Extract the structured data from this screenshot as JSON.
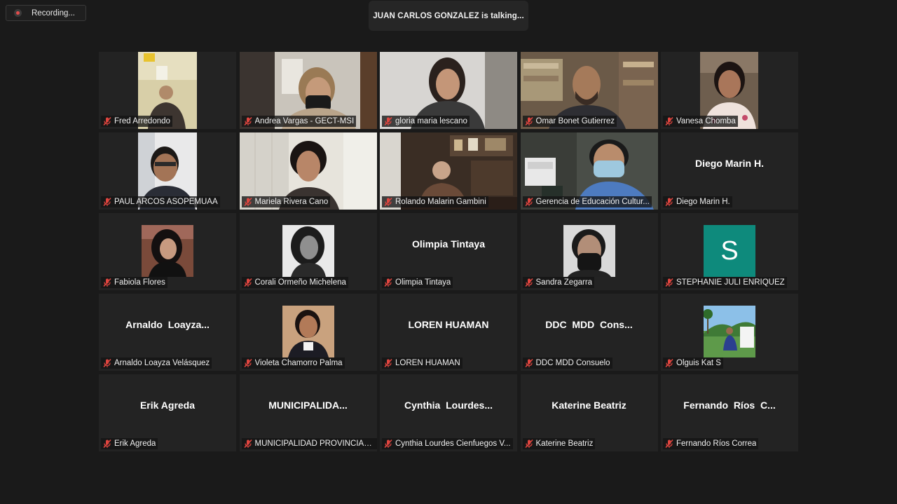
{
  "recording": {
    "label": "Recording..."
  },
  "talking": {
    "label": "JUAN CARLOS GONZALEZ is talking..."
  },
  "participants": [
    {
      "name": "Fred Arredondo",
      "center": ""
    },
    {
      "name": "Andrea Vargas - GECT-MSI",
      "center": ""
    },
    {
      "name": "gloria maria lescano",
      "center": ""
    },
    {
      "name": "Omar Bonet Gutierrez",
      "center": ""
    },
    {
      "name": "Vanesa Chomba",
      "center": ""
    },
    {
      "name": "PAUL ARCOS ASOPEMUAA",
      "center": ""
    },
    {
      "name": "Mariela Rivera Cano",
      "center": ""
    },
    {
      "name": "Rolando Malarin Gambini",
      "center": ""
    },
    {
      "name": "Gerencia de Educación Cultur...",
      "center": ""
    },
    {
      "name": "Diego Marin H.",
      "center": "Diego Marin H."
    },
    {
      "name": "Fabiola Flores",
      "center": ""
    },
    {
      "name": "Corali Ormeño Michelena",
      "center": ""
    },
    {
      "name": "Olimpia Tintaya",
      "center": "Olimpia Tintaya"
    },
    {
      "name": "Sandra Zegarra",
      "center": ""
    },
    {
      "name": "STEPHANIE JULI ENRIQUEZ",
      "center": "",
      "avatar_letter": "S"
    },
    {
      "name": "Arnaldo Loayza Velásquez",
      "center": "Arnaldo  Loayza..."
    },
    {
      "name": "Violeta Chamorro Palma",
      "center": ""
    },
    {
      "name": "LOREN HUAMAN",
      "center": "LOREN HUAMAN"
    },
    {
      "name": "DDC MDD Consuelo",
      "center": "DDC  MDD  Cons..."
    },
    {
      "name": "Olguis Kat S",
      "center": ""
    },
    {
      "name": "Erik Agreda",
      "center": "Erik Agreda"
    },
    {
      "name": "MUNICIPALIDAD PROVINCIAL ...",
      "center": "MUNICIPALIDA..."
    },
    {
      "name": "Cynthia Lourdes Cienfuegos V...",
      "center": "Cynthia  Lourdes..."
    },
    {
      "name": "Katerine Beatriz",
      "center": "Katerine Beatriz"
    },
    {
      "name": "Fernando Ríos Correa",
      "center": "Fernando  Ríos  C..."
    }
  ],
  "colors": {
    "background": "#1a1a1a",
    "tile": "#232323",
    "mute_icon": "#e0453f",
    "avatar_teal": "#0e8a7c"
  },
  "icons": {
    "recording": "record-dot-icon",
    "muted": "muted-microphone-icon"
  }
}
